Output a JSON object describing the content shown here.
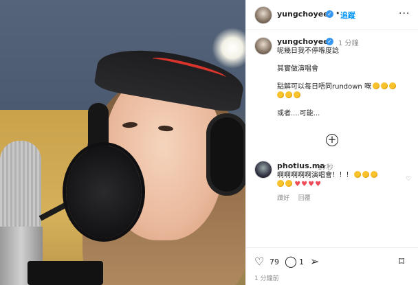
{
  "post": {
    "username": "yungchoyee",
    "verified_mark": "✓",
    "separator": "•",
    "follow_label": "追蹤",
    "more_label": "···"
  },
  "caption": {
    "username": "yungchoyee",
    "verified_mark": "✓",
    "time": "1 分鐘",
    "lines": [
      "呢幾日我不停喺度諗",
      "其實做演唱會",
      "點解可以每日唔同rundown 嘅",
      "或者....可能..."
    ],
    "emoji_count_line3": 5
  },
  "comment": {
    "username": "photius.ma",
    "time": "17秒",
    "text": "啊啊啊啊啊演唱會！！！",
    "hearts": "♥♥♥♥",
    "actions": [
      "讚好",
      "回覆"
    ],
    "like_icon": "♡"
  },
  "footer": {
    "like_count": "79",
    "comment_count": "1",
    "time": "1 分鐘前"
  },
  "icons": {
    "heart": "♡",
    "comment": "◯",
    "share": "➢",
    "bookmark": "⌑",
    "add": "+"
  },
  "colors": {
    "link_blue": "#0095f6",
    "verified_blue": "#3897f0",
    "heart_red": "#ed4956"
  }
}
